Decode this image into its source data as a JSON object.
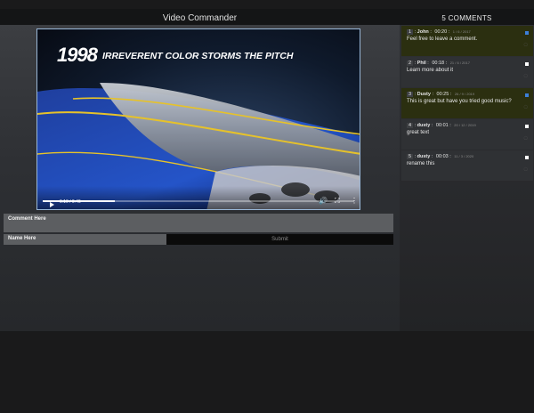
{
  "app": {
    "title": "Video Commander"
  },
  "comments_header": {
    "count_label": "5 COMMENTS"
  },
  "video": {
    "headline_year": "1998",
    "headline_text": "IRREVERENT COLOR STORMS THE PITCH",
    "time_label": "0:10 / 0:46",
    "progress": 0.23
  },
  "form": {
    "comment_placeholder": "Comment Here",
    "name_placeholder": "Name Here",
    "submit_label": "Submit"
  },
  "comments": [
    {
      "num": "1",
      "user": "John",
      "time": "00:20",
      "date": "1 / 6 / 2017",
      "text": "Feel free to leave a comment.",
      "checked": true
    },
    {
      "num": "2",
      "user": "Phil",
      "time": "00:18",
      "date": "21 / 6 / 2017",
      "text": "Learn more about it",
      "checked": false
    },
    {
      "num": "3",
      "user": "Dusty",
      "time": "00:25",
      "date": "26 / 9 / 2019",
      "text": "This is great but have you tried good music?",
      "checked": true
    },
    {
      "num": "4",
      "user": "dusty",
      "time": "00:01",
      "date": "20 / 12 / 2019",
      "text": "great text",
      "checked": false
    },
    {
      "num": "5",
      "user": "dusty",
      "time": "00:03",
      "date": "11 / 3 / 2020",
      "text": "rename this",
      "checked": false
    }
  ],
  "colors": {
    "highlight": "#2b2f10",
    "accent": "#3c7fd9"
  }
}
